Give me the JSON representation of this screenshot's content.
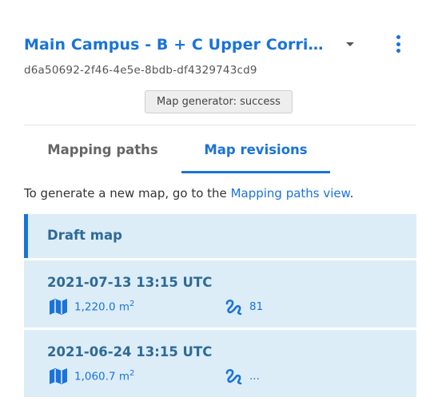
{
  "header": {
    "title": "Main Campus - B + C Upper Corridor",
    "uuid": "d6a50692-2f46-4e5e-8bdb-df4329743cd9",
    "status_badge": "Map generator: success"
  },
  "tabs": [
    {
      "label": "Mapping paths",
      "active": false
    },
    {
      "label": "Map revisions",
      "active": true
    }
  ],
  "info": {
    "prefix": "To generate a new map, go to the ",
    "link": "Mapping paths view",
    "suffix": "."
  },
  "draft": {
    "label": "Draft map"
  },
  "revisions": [
    {
      "date": "2021-07-13 13:15 UTC",
      "area": "1,220.0 m",
      "area_unit_sup": "2",
      "paths": "81"
    },
    {
      "date": "2021-06-24 13:15 UTC",
      "area": "1,060.7 m",
      "area_unit_sup": "2",
      "paths": "..."
    }
  ],
  "icons": {
    "area": "map-icon",
    "paths": "route-icon",
    "menu": "more-vert-icon",
    "dropdown": "caret-down-icon"
  },
  "colors": {
    "accent": "#1a73d9",
    "card_bg": "#dcedf8",
    "card_text": "#2f6a94"
  }
}
